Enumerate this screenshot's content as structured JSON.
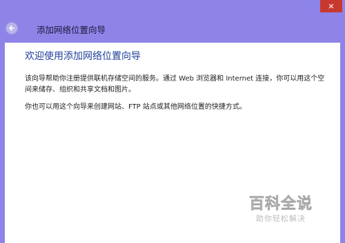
{
  "window": {
    "title": "添加网络位置向导",
    "close_glyph": "✕"
  },
  "wizard": {
    "heading": "欢迎使用添加网络位置向导",
    "paragraph1": "该向导帮助你注册提供联机存储空间的服务。通过 Web 浏览器和 Internet 连接，你可以用这个空间来储存、组织和共享文档和图片。",
    "paragraph2": "你也可以用这个向导来创建网站、FTP 站点或其他网络位置的快捷方式。"
  },
  "watermark": {
    "logo": "百科全说",
    "subtitle": "助你轻松解决"
  },
  "icons": {
    "back": "back-arrow-icon",
    "close": "close-icon"
  },
  "colors": {
    "frame": "#8e84e8",
    "close_button": "#c7392e",
    "heading_text": "#1f3f9b",
    "panel": "#ffffff"
  }
}
